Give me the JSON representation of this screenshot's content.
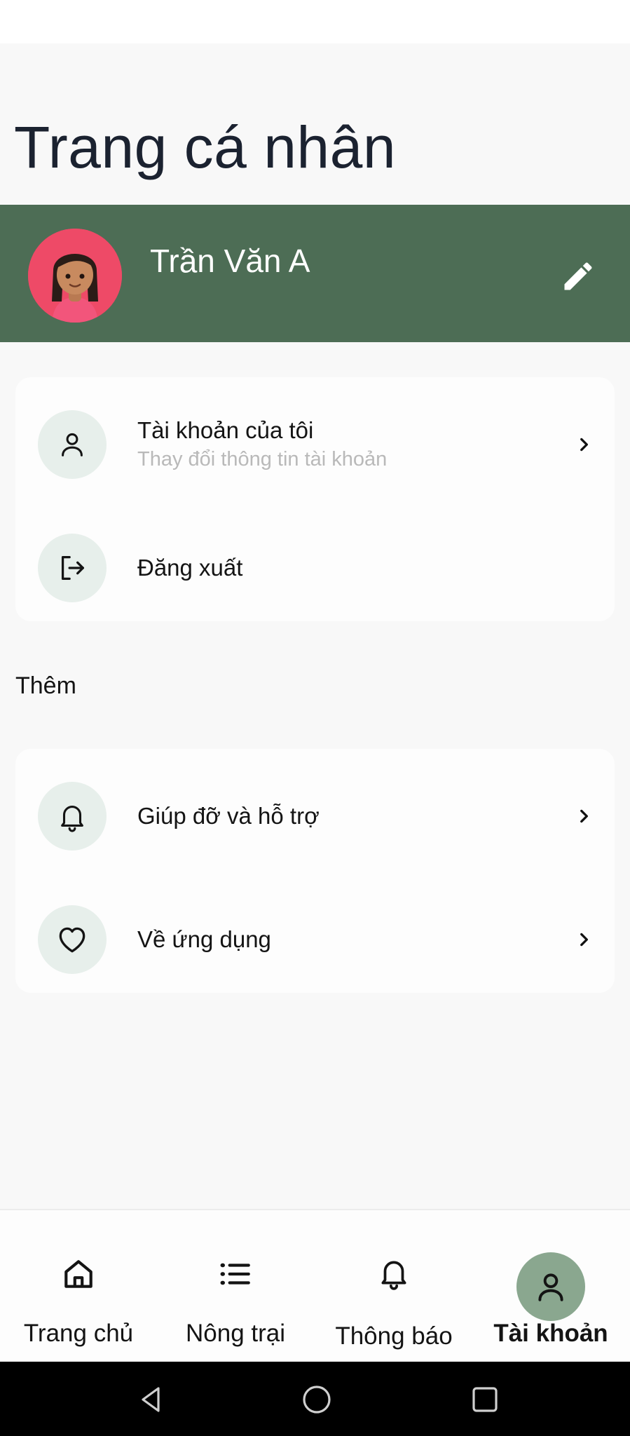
{
  "page": {
    "title": "Trang cá nhân"
  },
  "profile": {
    "name": "Trần Văn A",
    "edit_icon": "pencil-icon",
    "banner_color": "#4d6d55"
  },
  "account_menu": [
    {
      "icon": "user-icon",
      "title": "Tài khoản của tôi",
      "subtitle": "Thay đổi thông tin tài khoản",
      "has_chevron": true
    },
    {
      "icon": "logout-icon",
      "title": "Đăng xuất",
      "has_chevron": false
    }
  ],
  "more_section": {
    "label": "Thêm",
    "items": [
      {
        "icon": "bell-icon",
        "title": "Giúp đỡ và hỗ trợ",
        "has_chevron": true
      },
      {
        "icon": "heart-icon",
        "title": "Về ứng dụng",
        "has_chevron": true
      }
    ]
  },
  "bottom_nav": {
    "items": [
      {
        "icon": "home-icon",
        "label": "Trang chủ",
        "active": false
      },
      {
        "icon": "list-icon",
        "label": "Nông trại",
        "active": false
      },
      {
        "icon": "bell-icon",
        "label": "Thông báo",
        "active": false
      },
      {
        "icon": "user-icon",
        "label": "Tài khoản",
        "active": true
      }
    ],
    "active_color": "#8aa78f"
  },
  "system_nav": {
    "buttons": [
      "back-icon",
      "home-circle-icon",
      "recents-icon"
    ]
  }
}
